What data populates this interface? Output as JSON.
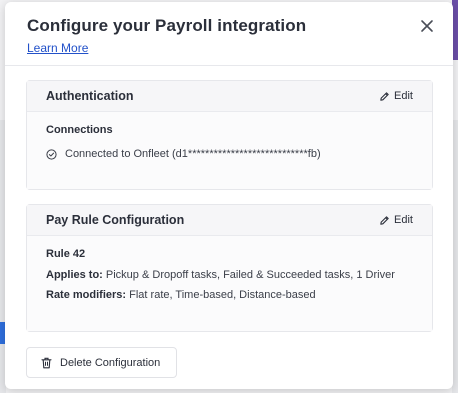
{
  "modal": {
    "title": "Configure your Payroll integration",
    "learn_more": "Learn More"
  },
  "authentication": {
    "title": "Authentication",
    "edit_label": "Edit",
    "connections_label": "Connections",
    "connection_text": "Connected to Onfleet (d1****************************fb)"
  },
  "pay_rule": {
    "title": "Pay Rule Configuration",
    "edit_label": "Edit",
    "rule_name": "Rule 42",
    "applies_label": "Applies to:",
    "applies_value": "Pickup & Dropoff tasks, Failed & Succeeded tasks, 1 Driver",
    "modifiers_label": "Rate modifiers:",
    "modifiers_value": "Flat rate, Time-based, Distance-based"
  },
  "footer": {
    "delete_label": "Delete Configuration"
  },
  "icons": {
    "close": "close-icon",
    "edit": "pencil-icon",
    "connected": "check-circle-icon",
    "delete": "trash-icon"
  }
}
